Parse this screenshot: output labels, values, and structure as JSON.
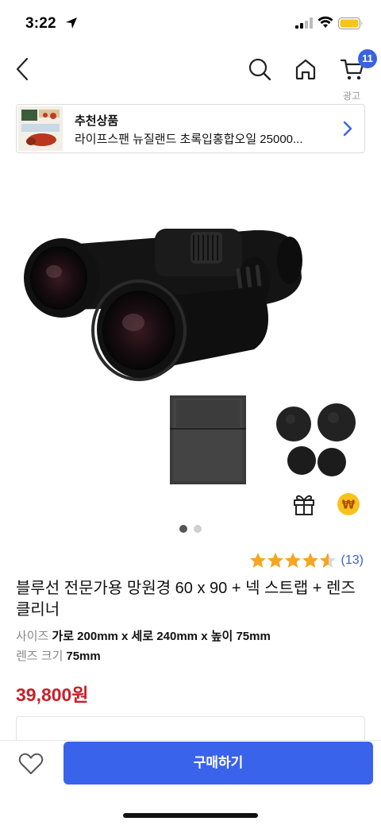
{
  "status_bar": {
    "time": "3:22"
  },
  "nav": {
    "cart_count": "11",
    "ad_label": "광고"
  },
  "recommended": {
    "title": "추천상품",
    "product_name": "라이프스팬 뉴질랜드 초록입홍합오일 25000..."
  },
  "gallery": {
    "current_slide": 1,
    "total_slides": 2
  },
  "rating": {
    "stars": 4.5,
    "review_count": "(13)"
  },
  "product": {
    "title": "블루선 전문가용 망원경 60 x 90 + 넥 스트랩 + 렌즈 클리너",
    "size_label": "사이즈",
    "size_value": "가로 200mm x 세로 240mm x 높이 75mm",
    "lens_label": "렌즈 크기",
    "lens_value": "75mm",
    "price": "39,800원"
  },
  "bottom": {
    "buy_label": "구매하기"
  },
  "colors": {
    "accent": "#3a63ec",
    "price": "#c8202a",
    "star": "#f5a623",
    "review_link": "#3a5fd0"
  }
}
